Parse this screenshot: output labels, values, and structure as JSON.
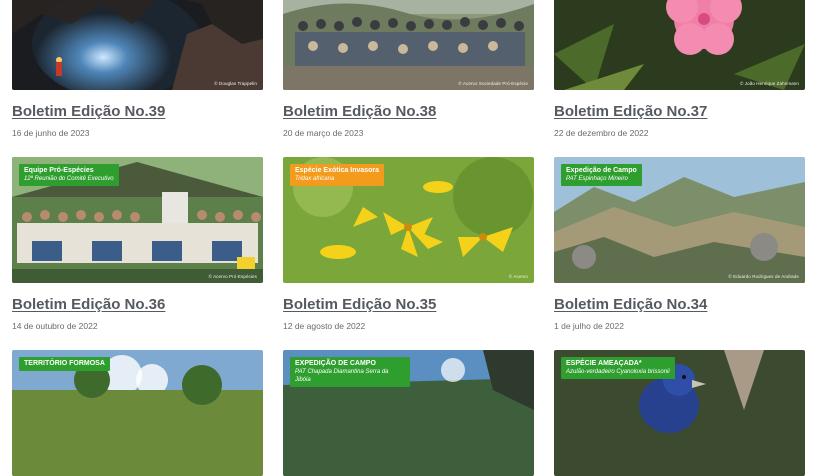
{
  "posts": [
    {
      "title": "Boletim Edição No.39",
      "date": "16 de junho de 2023",
      "image_credit": "© Douglas Trappelin"
    },
    {
      "title": "Boletim Edição No.38",
      "date": "20 de março de 2023",
      "image_credit": "© Acervo Sociedade Pró-Espécie"
    },
    {
      "title": "Boletim Edição No.37",
      "date": "22 de dezembro de 2022",
      "image_credit": "© João Henrique Zahnmann"
    },
    {
      "title": "Boletim Edição No.36",
      "date": "14 de outubro de 2022",
      "image_badge": "Equipe Pró-Espécies",
      "image_badge_sub": "12ª Reunião do Comitê Executivo",
      "image_credit": "© Acervo Pró-Espécies"
    },
    {
      "title": "Boletim Edição No.35",
      "date": "12 de agosto de 2022",
      "image_badge": "Espécie Exótica Invasora",
      "image_badge_sub": "Tridax africana",
      "image_credit": "© Acervo"
    },
    {
      "title": "Boletim Edição No.34",
      "date": "1 de julho de 2022",
      "image_badge": "Expedição de Campo",
      "image_badge_sub": "PAT Espinhaço Mineiro",
      "image_credit": "© Eduardo Rodrigues de Andrade"
    },
    {
      "image_badge": "TERRITÓRIO FORMOSA"
    },
    {
      "image_badge": "EXPEDIÇÃO DE CAMPO",
      "image_badge_sub": "PAT Chapada Diamantina Serra da Jibóia"
    },
    {
      "image_badge": "ESPÉCIE AMEAÇADA*",
      "image_badge_sub": "Azulão-verdadeiro Cyanoloxia brissonii"
    }
  ],
  "colors": {
    "title": "#555a60",
    "date": "#6b6b6b",
    "badge_green": "#2e9e2f",
    "badge_orange": "#f29b1d"
  }
}
